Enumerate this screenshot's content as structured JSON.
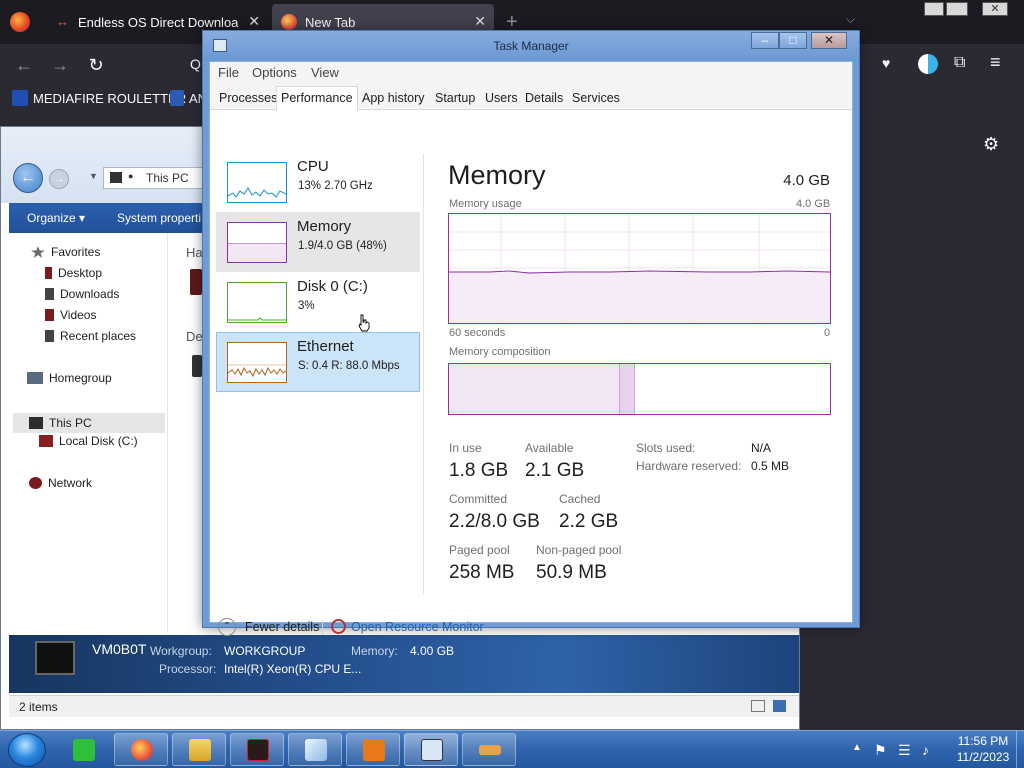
{
  "browser": {
    "tabs": [
      {
        "title": "Endless OS Direct Download | Er",
        "active": false
      },
      {
        "title": "New Tab",
        "active": true
      }
    ],
    "new_tab_symbol": "+",
    "address_glyph": "Q",
    "bookmarks": [
      {
        "label": "MEDIAFIRE ROULETTER"
      },
      {
        "label": "AN"
      }
    ]
  },
  "explorer": {
    "address": "This PC",
    "toolbar": {
      "organize": "Organize ▾",
      "system_properties": "System properti"
    },
    "nav": {
      "favorites": "Favorites",
      "desktop": "Desktop",
      "downloads": "Downloads",
      "videos": "Videos",
      "recent_places": "Recent places",
      "homegroup": "Homegroup",
      "this_pc": "This PC",
      "local_disk": "Local Disk (C:)",
      "network": "Network"
    },
    "pane_fragments": [
      "Ha",
      "De"
    ],
    "details": {
      "computer_name": "VM0B0T",
      "workgroup_label": "Workgroup:",
      "workgroup_value": "WORKGROUP",
      "memory_label": "Memory:",
      "memory_value": "4.00 GB",
      "processor_label": "Processor:",
      "processor_value": "Intel(R) Xeon(R) CPU E..."
    },
    "status": "2 items"
  },
  "task_manager": {
    "title": "Task Manager",
    "menu": [
      "File",
      "Options",
      "View"
    ],
    "tabs": [
      "Processes",
      "Performance",
      "App history",
      "Startup",
      "Users",
      "Details",
      "Services"
    ],
    "active_tab": "Performance",
    "perf_list": [
      {
        "name": "CPU",
        "value": "13% 2.70 GHz",
        "color": "#1e90c8"
      },
      {
        "name": "Memory",
        "value": "1.9/4.0 GB (48%)",
        "color": "#8b2fa0"
      },
      {
        "name": "Disk 0 (C:)",
        "value": "3%",
        "color": "#4ba82e"
      },
      {
        "name": "Ethernet",
        "value": "S: 0.4 R: 88.0 Mbps",
        "color": "#a7661d"
      }
    ],
    "memory": {
      "title": "Memory",
      "total": "4.0 GB",
      "usage_label": "Memory usage",
      "usage_max": "4.0 GB",
      "axis_left": "60 seconds",
      "axis_right": "0",
      "composition_label": "Memory composition",
      "in_use_fraction": 0.45,
      "modified_fraction": 0.04,
      "stats": {
        "in_use_label": "In use",
        "in_use": "1.8 GB",
        "available_label": "Available",
        "available": "2.1 GB",
        "committed_label": "Committed",
        "committed": "2.2/8.0 GB",
        "cached_label": "Cached",
        "cached": "2.2 GB",
        "paged_label": "Paged pool",
        "paged": "258 MB",
        "nonpaged_label": "Non-paged pool",
        "nonpaged": "50.9 MB",
        "slots_label": "Slots used:",
        "slots": "N/A",
        "hw_reserved_label": "Hardware reserved:",
        "hw_reserved": "0.5 MB"
      }
    },
    "footer": {
      "fewer_details": "Fewer details",
      "resource_monitor": "Open Resource Monitor"
    }
  },
  "taskbar": {
    "pinned": [
      "firefox-icon",
      "google-docs-icon",
      "firefox-icon",
      "file-explorer-icon",
      "system-icon",
      "notepad-icon",
      "java-icon",
      "task-manager-icon",
      "app-icon"
    ],
    "clock_time": "11:56 PM",
    "clock_date": "11/2/2023"
  },
  "colors": {
    "memory_accent": "#8b2fa0",
    "taskbar": "#2f64ad",
    "link": "#1f62b1",
    "selected": "#cce4f7"
  }
}
